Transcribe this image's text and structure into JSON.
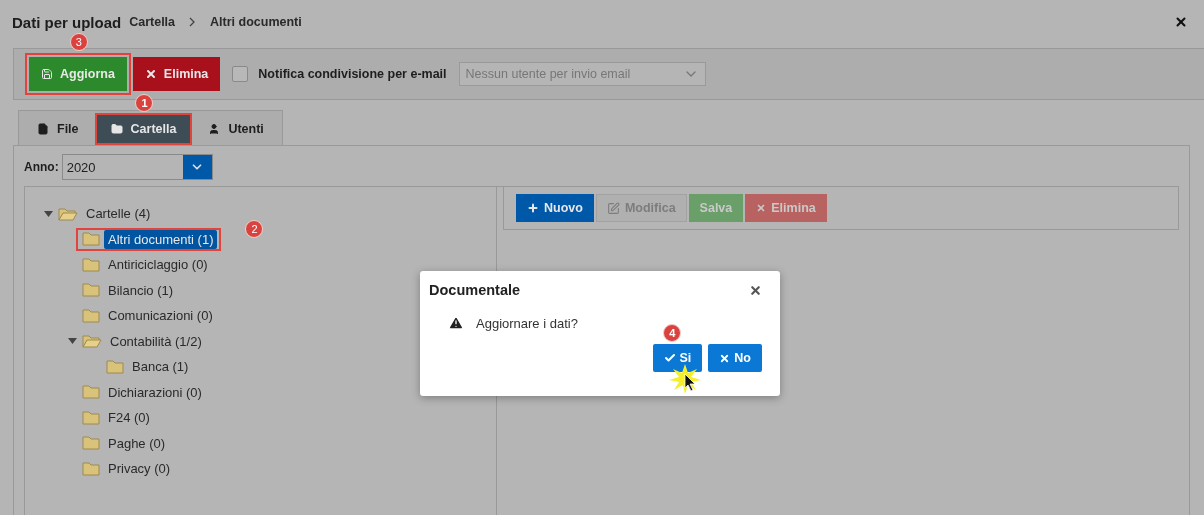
{
  "header": {
    "title": "Dati per upload",
    "breadcrumb": [
      "Cartella",
      "Altri documenti"
    ]
  },
  "toolbar": {
    "buttons": [
      {
        "kind": "save",
        "label": "Aggiorna",
        "highlighted": true,
        "callout": "3"
      },
      {
        "kind": "delete",
        "label": "Elimina",
        "highlighted": false
      }
    ],
    "notify": {
      "label": "Notifica condivisione per e-mail",
      "checked": false
    },
    "email_select": {
      "placeholder": "Nessun utente per invio email"
    }
  },
  "tabs": [
    {
      "kind": "file",
      "label": "File",
      "selected": false,
      "highlighted": false
    },
    {
      "kind": "folder",
      "label": "Cartella",
      "selected": true,
      "highlighted": true,
      "callout": "1"
    },
    {
      "kind": "user",
      "label": "Utenti",
      "selected": false,
      "highlighted": false
    }
  ],
  "year": {
    "label": "Anno:",
    "value": "2020"
  },
  "tree": [
    {
      "label": "Cartelle (4)",
      "expanded": true,
      "selected": false,
      "highlighted": false,
      "children": [
        {
          "label": "Altri documenti (1)",
          "selected": true,
          "highlighted": true,
          "callout": "2"
        },
        {
          "label": "Antiriciclaggio (0)",
          "selected": false,
          "highlighted": false
        },
        {
          "label": "Bilancio (1)",
          "selected": false,
          "highlighted": false
        },
        {
          "label": "Comunicazioni (0)",
          "selected": false,
          "highlighted": false
        },
        {
          "label": "Contabilità (1/2)",
          "expanded": true,
          "selected": false,
          "highlighted": false,
          "children": [
            {
              "label": "Banca (1)",
              "selected": false,
              "highlighted": false
            }
          ]
        },
        {
          "label": "Dichiarazioni (0)",
          "selected": false,
          "highlighted": false
        },
        {
          "label": "F24 (0)",
          "selected": false,
          "highlighted": false
        },
        {
          "label": "Paghe (0)",
          "selected": false,
          "highlighted": false
        },
        {
          "label": "Privacy (0)",
          "selected": false,
          "highlighted": false
        }
      ]
    }
  ],
  "actions": [
    {
      "kind": "new",
      "label": "Nuovo",
      "disabled": false
    },
    {
      "kind": "edit",
      "label": "Modifica",
      "disabled": true
    },
    {
      "kind": "save",
      "label": "Salva",
      "disabled": true
    },
    {
      "kind": "delete",
      "label": "Elimina",
      "disabled": true
    }
  ],
  "dialog": {
    "title": "Documentale",
    "message": "Aggiornare i dati?",
    "buttons": [
      {
        "kind": "confirm",
        "label": "Si",
        "callout": "4",
        "pointer": true
      },
      {
        "kind": "cancel",
        "label": "No",
        "pointer": false
      }
    ]
  }
}
